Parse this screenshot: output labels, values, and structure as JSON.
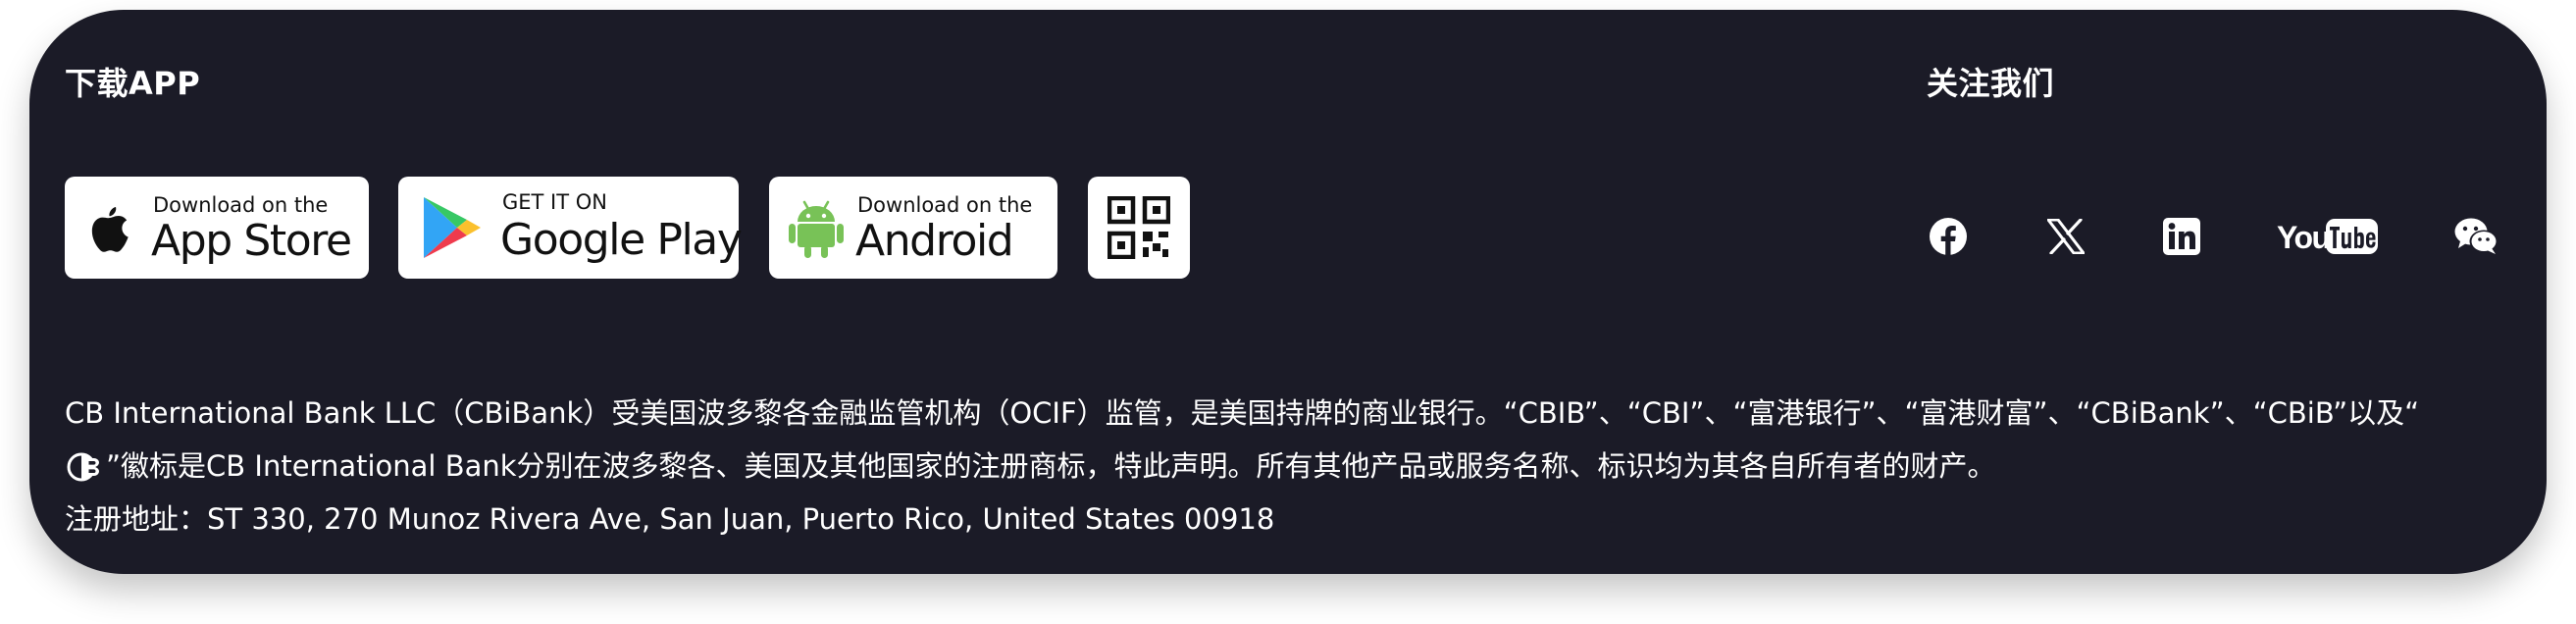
{
  "download": {
    "heading": "下载APP",
    "app_store": {
      "small": "Download on the",
      "big": "App Store"
    },
    "google_play": {
      "small": "GET IT ON",
      "big": "Google Play"
    },
    "android": {
      "small": "Download on the",
      "big": "Android"
    },
    "qr_icon": "qr-code-icon"
  },
  "follow": {
    "heading": "关注我们",
    "icons": [
      "facebook-icon",
      "x-icon",
      "linkedin-icon",
      "youtube-icon",
      "wechat-icon"
    ],
    "youtube_wordmark": "You"
  },
  "legal": {
    "line1": "CB International Bank LLC（CBiBank）受美国波多黎各金融监管机构（OCIF）监管，是美国持牌的商业银行。“CBIB”、“CBI”、“富港银行”、“富港财富”、“CBiBank”、“CBiB”以及“",
    "line2": "”徽标是CB International Bank分别在波多黎各、美国及其他国家的注册商标，特此声明。所有其他产品或服务名称、标识均为其各自所有者的财产。",
    "line3": "注册地址：ST 330, 270 Munoz Rivera Ave, San Juan, Puerto Rico, United States 00918"
  },
  "colors": {
    "background": "#1b1b27",
    "text": "#ffffff",
    "button": "#ffffff"
  }
}
